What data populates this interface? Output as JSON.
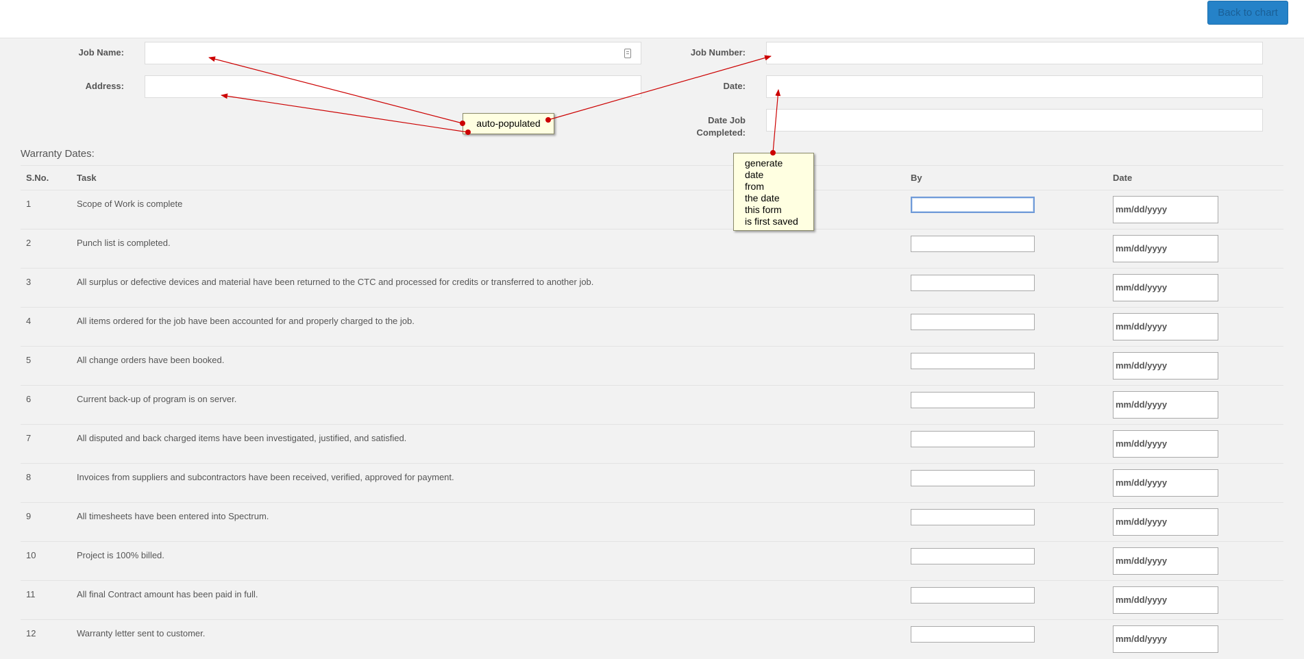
{
  "header": {
    "back_button": "Back to chart"
  },
  "job": {
    "name_label": "Job Name:",
    "number_label": "Job Number:",
    "address_label": "Address:",
    "date_label": "Date:",
    "completed_label_line1": "Date Job",
    "completed_label_line2": "Completed:"
  },
  "warranty": {
    "title": "Warranty Dates:",
    "headers": {
      "sno": "S.No.",
      "task": "Task",
      "by": "By",
      "date": "Date"
    },
    "rows": [
      {
        "sno": "1",
        "task": "Scope of Work is complete",
        "date": "mm/dd/yyyy"
      },
      {
        "sno": "2",
        "task": "Punch list is completed.",
        "date": "mm/dd/yyyy"
      },
      {
        "sno": "3",
        "task": "All surplus or defective devices and material have been returned to the CTC and processed for credits or transferred to another job.",
        "date": "mm/dd/yyyy"
      },
      {
        "sno": "4",
        "task": "All items ordered for the job have been accounted for and properly charged to the job.",
        "date": "mm/dd/yyyy"
      },
      {
        "sno": "5",
        "task": "All change orders have been booked.",
        "date": "mm/dd/yyyy"
      },
      {
        "sno": "6",
        "task": "Current back-up of program is on server.",
        "date": "mm/dd/yyyy"
      },
      {
        "sno": "7",
        "task": "All disputed and back charged items have been investigated, justified, and satisfied.",
        "date": "mm/dd/yyyy"
      },
      {
        "sno": "8",
        "task": "Invoices from suppliers and subcontractors have been received, verified, approved for payment.",
        "date": "mm/dd/yyyy"
      },
      {
        "sno": "9",
        "task": "All timesheets have been entered into Spectrum.",
        "date": "mm/dd/yyyy"
      },
      {
        "sno": "10",
        "task": "Project is 100% billed.",
        "date": "mm/dd/yyyy"
      },
      {
        "sno": "11",
        "task": "All final Contract amount has been paid in full.",
        "date": "mm/dd/yyyy"
      },
      {
        "sno": "12",
        "task": "Warranty letter sent to customer.",
        "date": "mm/dd/yyyy"
      }
    ]
  },
  "annotations": {
    "auto": "auto-populated",
    "generate_lines": [
      "generate",
      "date",
      "from",
      "the date",
      "this form",
      "is first saved"
    ]
  },
  "colors": {
    "accent": "#2582c8",
    "note_bg": "#ffffe1",
    "arrow": "#cc0000",
    "page_bg": "#f2f2f2"
  },
  "icons": {
    "name_field": "contact-card-icon"
  }
}
